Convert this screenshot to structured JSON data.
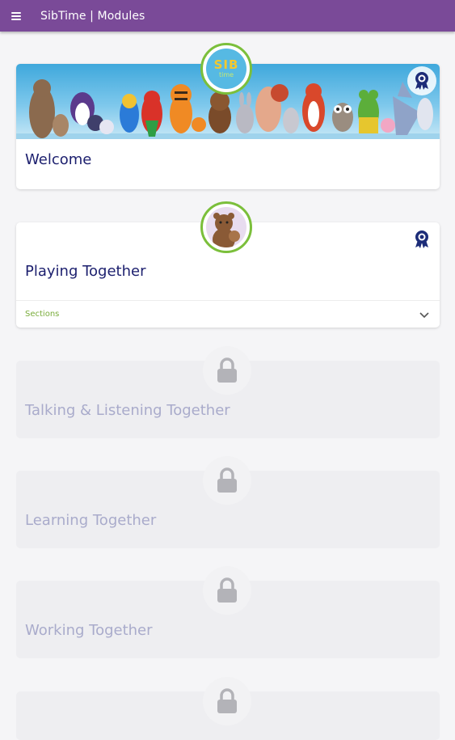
{
  "appbar": {
    "title": "SibTime | Modules",
    "menu_icon": "hamburger-menu-icon"
  },
  "colors": {
    "appbar": "#7a4a98",
    "title": "#1c1f6e",
    "locked_title": "#a9abcb",
    "accent_green": "#7bbf3b",
    "sections_green": "#79ac3a"
  },
  "modules": [
    {
      "title": "Welcome",
      "state": "unlocked",
      "logo_text": "SIB",
      "logo_subtext": "time",
      "badge_icon": "award-ribbon-icon"
    },
    {
      "title": "Playing Together",
      "state": "unlocked",
      "badge_icon": "award-ribbon-icon",
      "sections_label": "Sections",
      "sections_icon": "chevron-down-icon"
    },
    {
      "title": "Talking & Listening Together",
      "state": "locked",
      "icon": "lock-icon"
    },
    {
      "title": "Learning Together",
      "state": "locked",
      "icon": "lock-icon"
    },
    {
      "title": "Working Together",
      "state": "locked",
      "icon": "lock-icon"
    },
    {
      "title": "",
      "state": "locked",
      "icon": "lock-icon"
    }
  ]
}
